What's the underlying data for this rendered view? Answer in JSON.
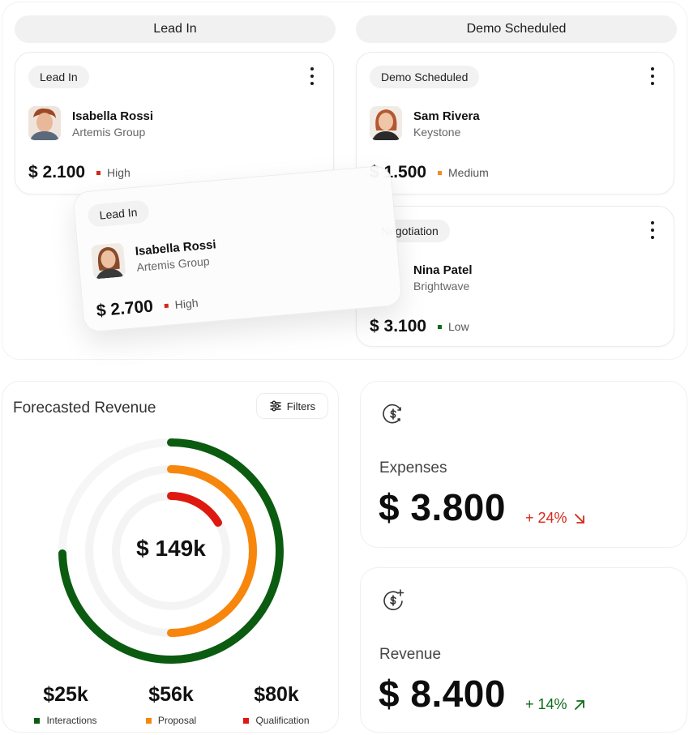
{
  "board": {
    "columns": [
      "Lead In",
      "Demo Scheduled"
    ],
    "cards": [
      {
        "stage": "Lead In",
        "name": "Isabella Rossi",
        "company": "Artemis Group",
        "amount": "$ 2.100",
        "priority": "High",
        "priority_color": "#d62718"
      },
      {
        "stage": "Demo Scheduled",
        "name": "Sam Rivera",
        "company": "Keystone",
        "amount": "$ 1.500",
        "priority": "Medium",
        "priority_color": "#f58a1f"
      },
      {
        "stage": "Negotiation",
        "name": "Nina Patel",
        "company": "Brightwave",
        "amount": "$ 3.100",
        "priority": "Low",
        "priority_color": "#0f6b1a"
      }
    ],
    "dragging_card": {
      "stage": "Lead In",
      "name": "Isabella Rossi",
      "company": "Artemis Group",
      "amount": "$ 2.700",
      "priority": "High",
      "priority_color": "#d62718"
    }
  },
  "forecast": {
    "title": "Forecasted Revenue",
    "filters_label": "Filters",
    "total": "$ 149k",
    "segments": [
      {
        "value": "$25k",
        "label": "Interactions",
        "color": "#0b5c10"
      },
      {
        "value": "$56k",
        "label": "Proposal",
        "color": "#f7860c"
      },
      {
        "value": "$80k",
        "label": "Qualification",
        "color": "#de1a10"
      }
    ]
  },
  "stats": {
    "expenses": {
      "label": "Expenses",
      "value": "$ 3.800",
      "change": "+ 24%",
      "color": "#d62718",
      "icon": "dollar-cycle-icon"
    },
    "revenue": {
      "label": "Revenue",
      "value": "$ 8.400",
      "change": "+ 14%",
      "color": "#0f6b1a",
      "icon": "dollar-plus-icon"
    }
  }
}
